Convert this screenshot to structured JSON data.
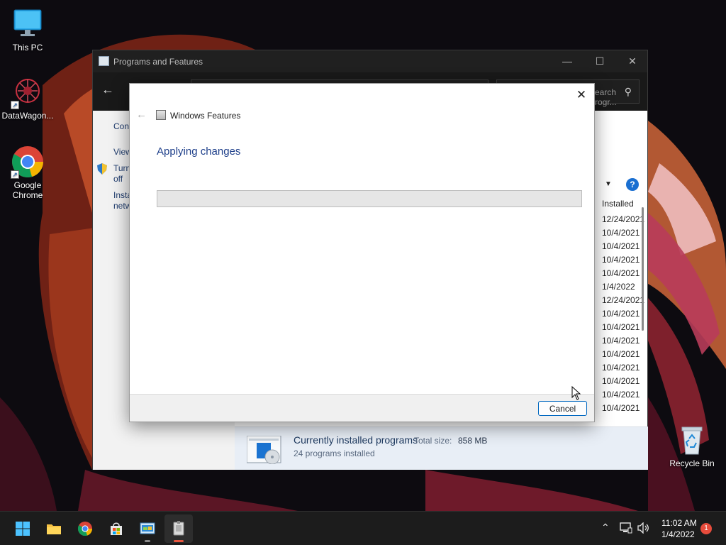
{
  "desktop": {
    "icons": [
      {
        "label": "This PC",
        "icon": "monitor-icon"
      },
      {
        "label": "DataWagon...",
        "icon": "datawagon-icon"
      },
      {
        "label": "Google Chrome",
        "icon": "chrome-icon"
      },
      {
        "label": "Recycle Bin",
        "icon": "recycle-bin-icon"
      }
    ]
  },
  "programs_window": {
    "title": "Programs and Features",
    "search_placeholder": "Search Progr...",
    "left_links": [
      "Cont",
      "View",
      "Turn",
      "off",
      "Insta",
      "netw"
    ],
    "column_header": "Installed",
    "dates": [
      "12/24/2021",
      "10/4/2021",
      "10/4/2021",
      "10/4/2021",
      "10/4/2021",
      "1/4/2022",
      "12/24/2021",
      "10/4/2021",
      "10/4/2021",
      "10/4/2021",
      "10/4/2021",
      "10/4/2021",
      "10/4/2021",
      "10/4/2021",
      "10/4/2021"
    ],
    "help_label": "?",
    "status": {
      "title": "Currently installed programs",
      "total_size_label": "Total size:",
      "total_size_value": "858 MB",
      "count_text": "24 programs installed"
    }
  },
  "features_dialog": {
    "title": "Windows Features",
    "heading": "Applying changes",
    "progress_fraction": 0.0,
    "cancel_label": "Cancel",
    "close_glyph": "✕",
    "back_glyph": "←"
  },
  "taskbar": {
    "apps": [
      {
        "name": "start",
        "icon": "windows-start-icon"
      },
      {
        "name": "file-explorer",
        "icon": "folder-icon"
      },
      {
        "name": "chrome",
        "icon": "chrome-icon"
      },
      {
        "name": "store",
        "icon": "store-icon"
      },
      {
        "name": "control-panel",
        "icon": "control-panel-icon"
      },
      {
        "name": "windows-features",
        "icon": "windows-features-icon"
      }
    ],
    "clock_time": "11:02 AM",
    "clock_date": "1/4/2022",
    "notification_count": "1"
  },
  "colors": {
    "accent": "#0067c0",
    "heading_blue": "#1e3f8a",
    "taskbar_bg": "#1c1c1c",
    "notification_red": "#e74c3c"
  }
}
